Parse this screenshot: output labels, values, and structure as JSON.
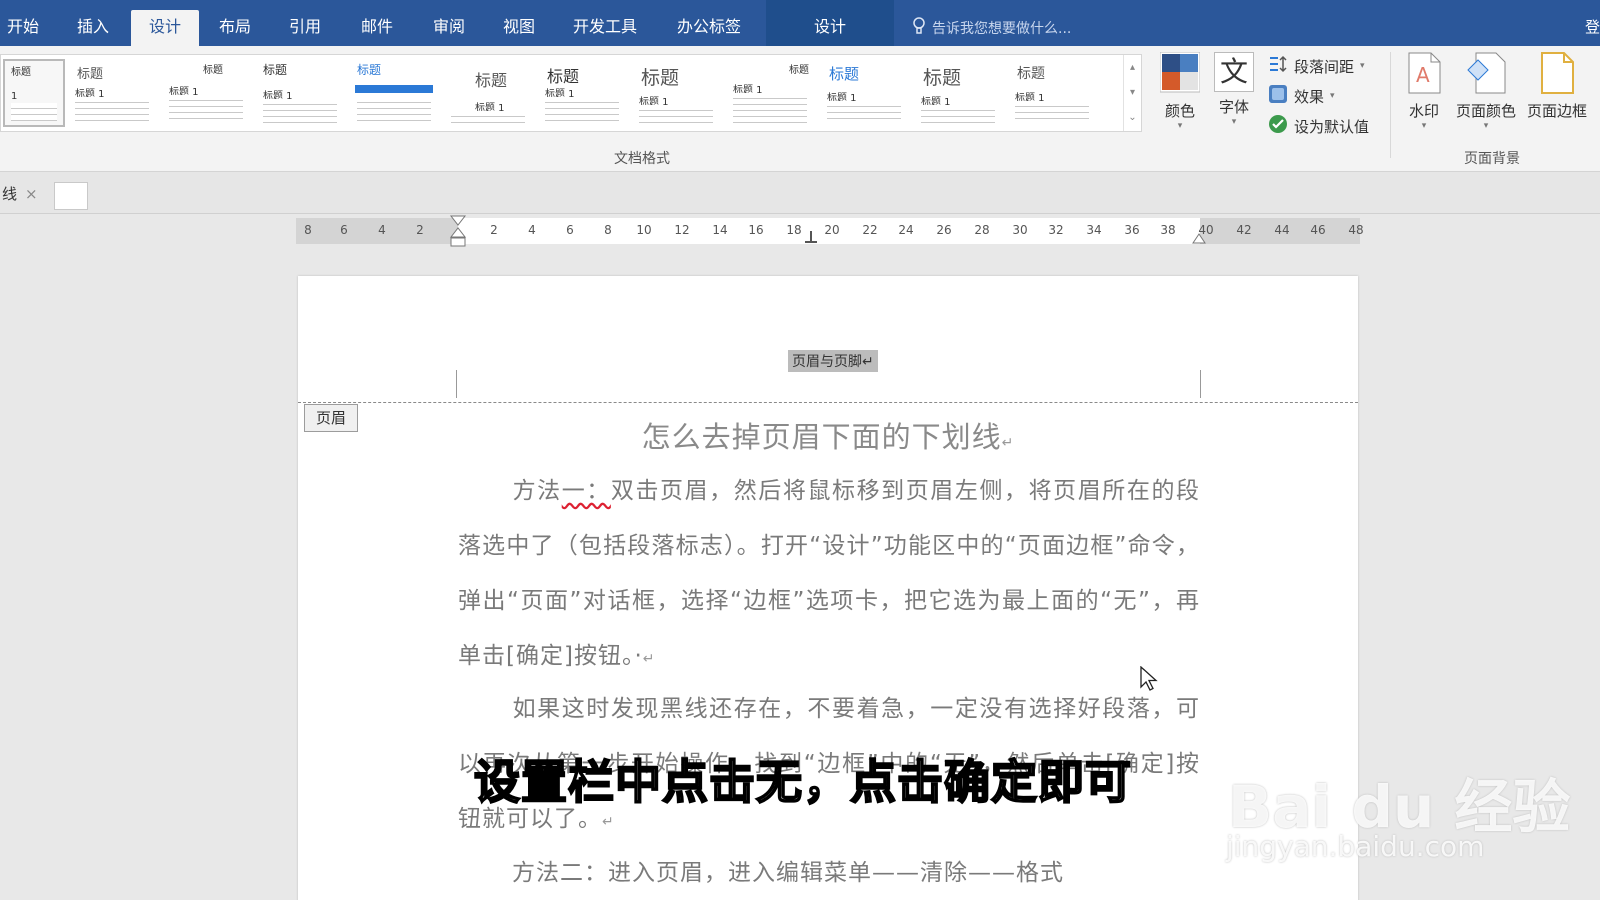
{
  "ribbon_tabs": [
    {
      "label": "开始"
    },
    {
      "label": "插入"
    },
    {
      "label": "设计"
    },
    {
      "label": "布局"
    },
    {
      "label": "引用"
    },
    {
      "label": "邮件"
    },
    {
      "label": "审阅"
    },
    {
      "label": "视图"
    },
    {
      "label": "开发工具"
    },
    {
      "label": "办公标签"
    }
  ],
  "active_tab": "设计",
  "contextual_tab": "设计",
  "tell_me": "告诉我您想要做什么...",
  "sign_in": "登",
  "doc_format_group": {
    "label": "文档格式",
    "styles": [
      {
        "heading": "标题",
        "sub": "1"
      },
      {
        "heading": "标题",
        "sub": "标题 1"
      },
      {
        "heading": "标题",
        "sub": "标题 1"
      },
      {
        "heading": "标题",
        "sub": "标题 1"
      },
      {
        "heading": "标题",
        "sub": ""
      },
      {
        "heading": "标题",
        "sub": "标题 1"
      },
      {
        "heading": "标题",
        "sub": "标题 1"
      },
      {
        "heading": "标题",
        "sub": "标题 1"
      },
      {
        "heading": "标题",
        "sub": "标题 1"
      },
      {
        "heading": "标题",
        "sub": "标题 1"
      },
      {
        "heading": "标题",
        "sub": "标题 1"
      },
      {
        "heading": "标题",
        "sub": "标题 1"
      }
    ],
    "colors_label": "颜色",
    "fonts_label": "字体",
    "fonts_glyph": "文",
    "paragraph_spacing_label": "段落间距",
    "effects_label": "效果",
    "set_default_label": "设为默认值"
  },
  "page_background_group": {
    "label": "页面背景",
    "watermark_label": "水印",
    "page_color_label": "页面颜色",
    "page_borders_label": "页面边框"
  },
  "doc_tab": {
    "label": "线",
    "close": "×"
  },
  "ruler_ticks": [
    "8",
    "6",
    "4",
    "2",
    "2",
    "4",
    "6",
    "8",
    "10",
    "12",
    "14",
    "16",
    "18",
    "20",
    "22",
    "24",
    "26",
    "28",
    "30",
    "32",
    "34",
    "36",
    "38",
    "40",
    "42",
    "44",
    "46",
    "48"
  ],
  "page": {
    "hf_label": "页眉与页脚↵",
    "header_tag": "页眉",
    "title": "怎么去掉页眉下面的下划线",
    "para1_prefix": "方法",
    "para1_squiggle": "一：",
    "para1_rest": "双击页眉，然后将鼠标移到页眉左侧，将页眉所在的段落选中了（包括段落标志）。打开“设计”功能区中的“页面边框”命令，弹出“页面”对话框，选择“边框”选项卡，把它选为最上面的“无”，再单击[确定]按钮。·",
    "para2": "如果这时发现黑线还存在，不要着急，一定没有选择好段落，可以再次从第一步开始操作，找到“边框”中的“无”，然后单击[确定]按钮就可以了。",
    "para3": "方法二：进入页眉，进入编辑菜单——清除——格式",
    "para_mark": "↵"
  },
  "subtitle": "设置栏中点击无，点击确定即可",
  "watermark": {
    "logo": "Bai du 经验",
    "url": "jingyan.baidu.com"
  },
  "colors": {
    "ribbon_blue": "#2b579a",
    "ribbon_bg": "#f3f3f3"
  }
}
